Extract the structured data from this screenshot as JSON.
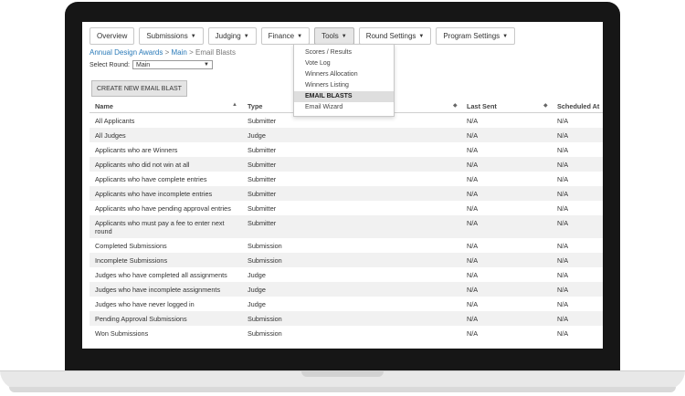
{
  "nav": {
    "tabs": [
      {
        "label": "Overview",
        "dropdown": false
      },
      {
        "label": "Submissions",
        "dropdown": true
      },
      {
        "label": "Judging",
        "dropdown": true
      },
      {
        "label": "Finance",
        "dropdown": true
      },
      {
        "label": "Tools",
        "dropdown": true
      },
      {
        "label": "Round Settings",
        "dropdown": true
      },
      {
        "label": "Program Settings",
        "dropdown": true
      }
    ],
    "active_tab": "Tools"
  },
  "breadcrumb": {
    "program": "Annual Design Awards",
    "sep1": ">",
    "round": "Main",
    "sep2": ">",
    "current": "Email Blasts"
  },
  "round_select": {
    "label": "Select Round:",
    "value": "Main"
  },
  "create_button": "CREATE NEW EMAIL BLAST",
  "tools_menu": {
    "items": [
      "Scores / Results",
      "Vote Log",
      "Winners Allocation",
      "Winners Listing",
      "EMAIL BLASTS",
      "Email Wizard"
    ],
    "active_index": 4
  },
  "table": {
    "headers": {
      "name": "Name",
      "type": "Type",
      "last_sent": "Last Sent",
      "scheduled": "Scheduled At"
    },
    "rows": [
      {
        "name": "All Applicants",
        "type": "Submitter",
        "last_sent": "N/A",
        "scheduled": "N/A"
      },
      {
        "name": "All Judges",
        "type": "Judge",
        "last_sent": "N/A",
        "scheduled": "N/A"
      },
      {
        "name": "Applicants who are Winners",
        "type": "Submitter",
        "last_sent": "N/A",
        "scheduled": "N/A"
      },
      {
        "name": "Applicants who did not win at all",
        "type": "Submitter",
        "last_sent": "N/A",
        "scheduled": "N/A"
      },
      {
        "name": "Applicants who have complete entries",
        "type": "Submitter",
        "last_sent": "N/A",
        "scheduled": "N/A"
      },
      {
        "name": "Applicants who have incomplete entries",
        "type": "Submitter",
        "last_sent": "N/A",
        "scheduled": "N/A"
      },
      {
        "name": "Applicants who have pending approval entries",
        "type": "Submitter",
        "last_sent": "N/A",
        "scheduled": "N/A"
      },
      {
        "name": "Applicants who must pay a fee to enter next round",
        "type": "Submitter",
        "last_sent": "N/A",
        "scheduled": "N/A"
      },
      {
        "name": "Completed Submissions",
        "type": "Submission",
        "last_sent": "N/A",
        "scheduled": "N/A"
      },
      {
        "name": "Incomplete Submissions",
        "type": "Submission",
        "last_sent": "N/A",
        "scheduled": "N/A"
      },
      {
        "name": "Judges who have completed all assignments",
        "type": "Judge",
        "last_sent": "N/A",
        "scheduled": "N/A"
      },
      {
        "name": "Judges who have incomplete assignments",
        "type": "Judge",
        "last_sent": "N/A",
        "scheduled": "N/A"
      },
      {
        "name": "Judges who have never logged in",
        "type": "Judge",
        "last_sent": "N/A",
        "scheduled": "N/A"
      },
      {
        "name": "Pending Approval Submissions",
        "type": "Submission",
        "last_sent": "N/A",
        "scheduled": "N/A"
      },
      {
        "name": "Won Submissions",
        "type": "Submission",
        "last_sent": "N/A",
        "scheduled": "N/A"
      }
    ]
  }
}
